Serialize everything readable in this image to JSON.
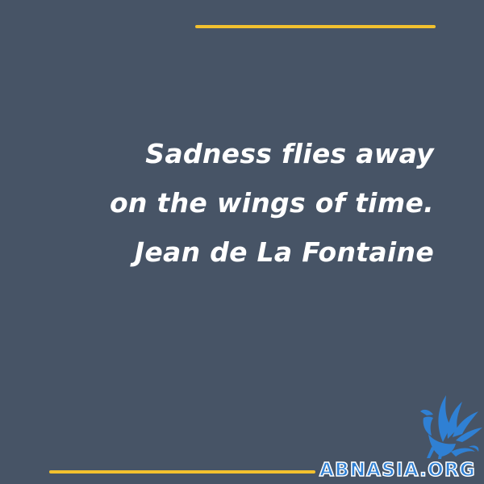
{
  "quote": {
    "lines": [
      "Sadness flies away",
      "on the wings of time.",
      "Jean de La Fontaine"
    ]
  },
  "brand": {
    "logo_icon": "winged-griffin-icon",
    "wordmark": "ABNASIA.ORG"
  },
  "colors": {
    "background": "#475466",
    "accent_rule": "#f2c12e",
    "text": "#ffffff",
    "logo_blue": "#2f80d4"
  }
}
